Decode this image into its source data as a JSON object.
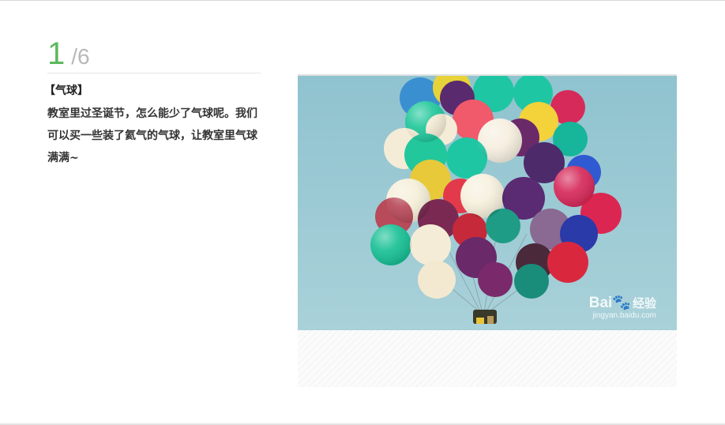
{
  "step_counter": {
    "current": "1",
    "separator": "/",
    "total": "6"
  },
  "step": {
    "title": "【气球】",
    "text": "教室里过圣诞节，怎么能少了气球呢。我们可以买一些装了氦气的气球，让教室里气球满满~"
  },
  "image": {
    "subject": "balloon-cluster-photo",
    "watermark_brand": "Bai",
    "watermark_brand_sub": "经验",
    "watermark_site": "jingyan.baidu.com"
  },
  "colors": {
    "accent_green": "#5cb85c",
    "muted_gray": "#b8b8b8",
    "sky": "#9ccbd6"
  }
}
